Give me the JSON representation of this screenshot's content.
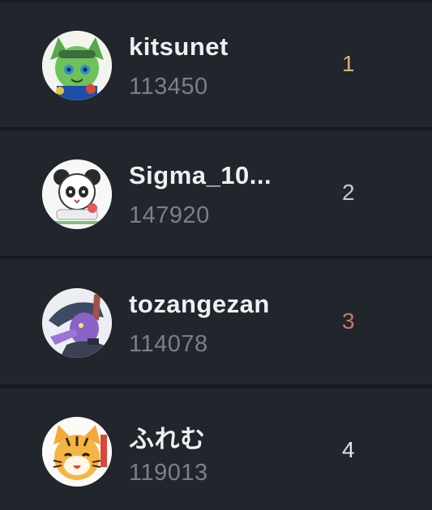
{
  "leaderboard": {
    "entries": [
      {
        "username": "kitsunet",
        "score": "113450",
        "rank": "1",
        "rank_color": "#d8b46a",
        "avatar_icon": "green-character-avatar-icon"
      },
      {
        "username": "Sigma_10...",
        "score": "147920",
        "rank": "2",
        "rank_color": "#c7cbd2",
        "avatar_icon": "panda-character-avatar-icon"
      },
      {
        "username": "tozangezan",
        "score": "114078",
        "rank": "3",
        "rank_color": "#c87a64",
        "avatar_icon": "purple-character-avatar-icon"
      },
      {
        "username": "ふれむ",
        "score": "119013",
        "rank": "4",
        "rank_color": "#e4e6ea",
        "avatar_icon": "tiger-character-avatar-icon"
      }
    ]
  }
}
